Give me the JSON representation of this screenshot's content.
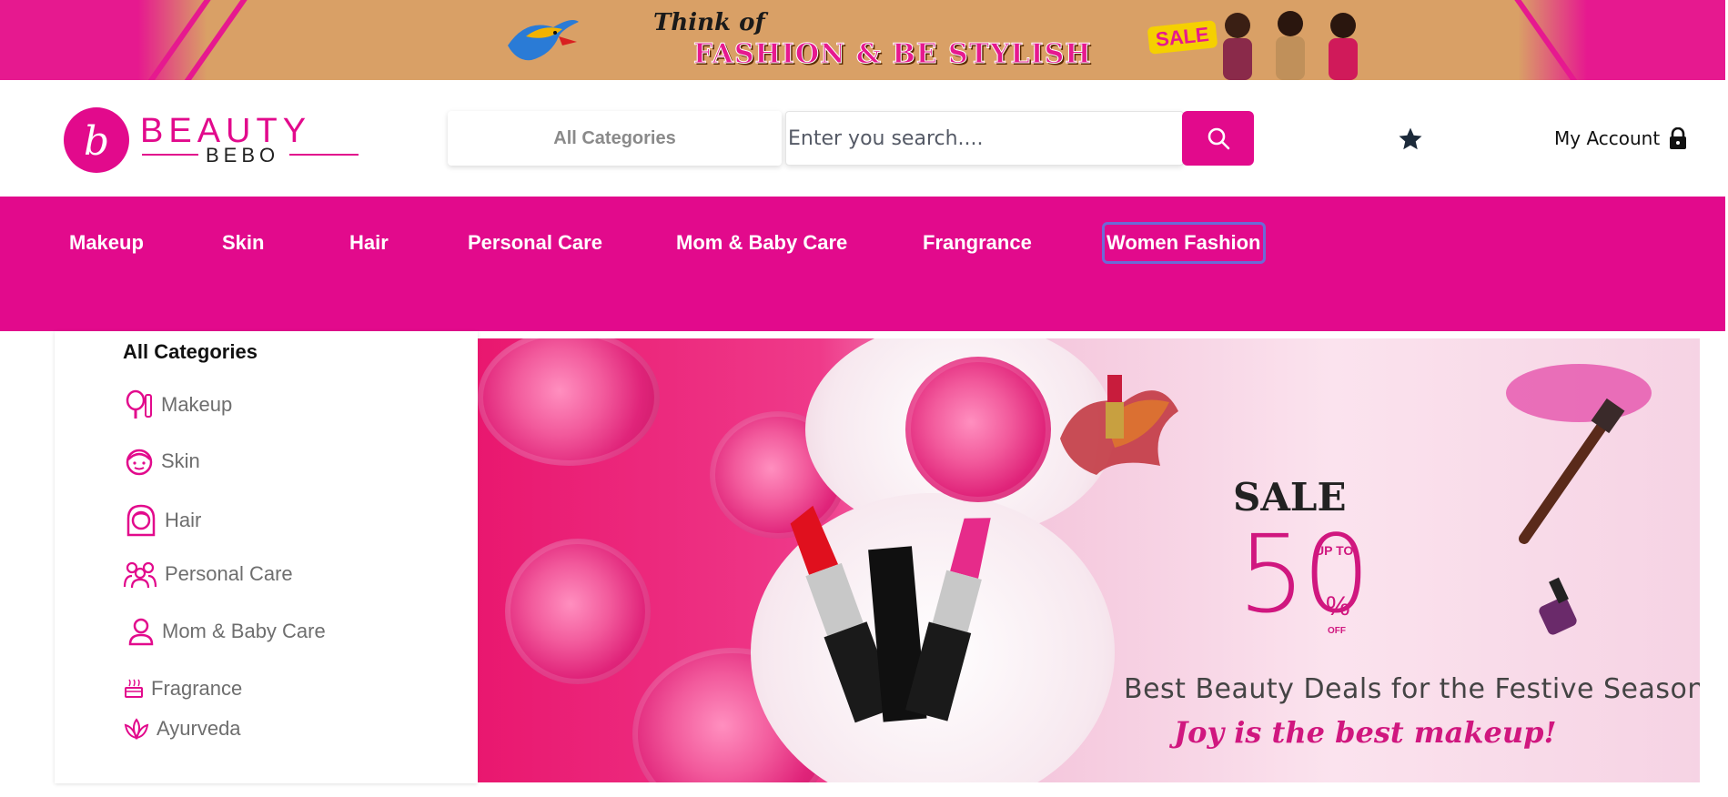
{
  "promo": {
    "think": "Think of",
    "headline": "FASHION & BE STYLISH",
    "sale_tag": "SALE"
  },
  "header": {
    "logo": {
      "name": "BEAUTY",
      "sub": "BEBO"
    },
    "category_select": "All Categories",
    "search": {
      "placeholder": "Enter you search....",
      "button_icon": "search-icon"
    },
    "wishlist_icon": "star-icon",
    "account": {
      "label": "My Account",
      "icon": "lock-icon"
    }
  },
  "nav": {
    "items": [
      {
        "label": "Makeup"
      },
      {
        "label": "Skin"
      },
      {
        "label": "Hair"
      },
      {
        "label": "Personal Care"
      },
      {
        "label": "Mom & Baby Care"
      },
      {
        "label": "Frangrance"
      },
      {
        "label": "Women Fashion",
        "active": true
      }
    ]
  },
  "sidebar": {
    "title": "All Categories",
    "items": [
      {
        "label": "Makeup",
        "icon": "mirror-comb-icon"
      },
      {
        "label": "Skin",
        "icon": "face-icon"
      },
      {
        "label": "Hair",
        "icon": "hair-icon"
      },
      {
        "label": "Personal Care",
        "icon": "people-icon"
      },
      {
        "label": "Mom & Baby Care",
        "icon": "person-icon"
      },
      {
        "label": "Fragrance",
        "icon": "fragrance-icon"
      },
      {
        "label": "Ayurveda",
        "icon": "lotus-icon"
      }
    ]
  },
  "hero": {
    "sale": "SALE",
    "percent": "50",
    "up_to": "UP TO",
    "percent_sign": "%",
    "off": "OFF",
    "tagline": "Best Beauty Deals for the Festive Season",
    "slogan": "Joy is the best makeup!"
  },
  "colors": {
    "brand": "#e20a8c",
    "promo_bg": "#d9a066",
    "active_outline": "#6b6bd6"
  }
}
